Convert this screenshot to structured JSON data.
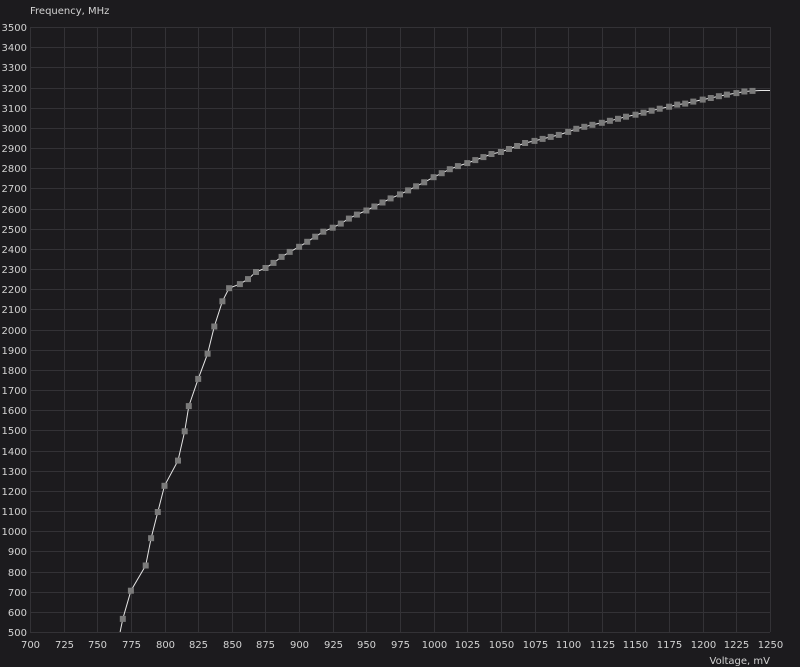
{
  "chart_data": {
    "type": "line",
    "ylabel": "Frequency, MHz",
    "xlabel": "Voltage, mV",
    "xlim": [
      700,
      1250
    ],
    "ylim": [
      500,
      3500
    ],
    "x_ticks": [
      700,
      725,
      750,
      775,
      800,
      825,
      850,
      875,
      900,
      925,
      950,
      975,
      1000,
      1025,
      1050,
      1075,
      1100,
      1125,
      1150,
      1175,
      1200,
      1225,
      1250
    ],
    "y_ticks": [
      500,
      600,
      700,
      800,
      900,
      1000,
      1100,
      1200,
      1300,
      1400,
      1500,
      1600,
      1700,
      1800,
      1900,
      2000,
      2100,
      2200,
      2300,
      2400,
      2500,
      2600,
      2700,
      2800,
      2900,
      3000,
      3100,
      3200,
      3300,
      3400,
      3500
    ],
    "grid": true,
    "colors": {
      "background": "#1c1b1e",
      "grid": "#333236",
      "line": "#e6e6e6",
      "marker": "#7a7a7a",
      "text": "#d2d2d2"
    },
    "series": [
      {
        "points": [
          [
            767,
            500
          ],
          [
            769,
            565
          ],
          [
            775,
            705
          ],
          [
            786,
            830
          ],
          [
            790,
            965
          ],
          [
            795,
            1095
          ],
          [
            800,
            1225
          ],
          [
            810,
            1350
          ],
          [
            815,
            1495
          ],
          [
            818,
            1620
          ],
          [
            825,
            1755
          ],
          [
            832,
            1880
          ],
          [
            837,
            2015
          ],
          [
            843,
            2140
          ],
          [
            848,
            2205
          ],
          [
            856,
            2225
          ],
          [
            862,
            2250
          ],
          [
            868,
            2285
          ],
          [
            875,
            2305
          ],
          [
            881,
            2330
          ],
          [
            887,
            2360
          ],
          [
            893,
            2385
          ],
          [
            900,
            2410
          ],
          [
            906,
            2435
          ],
          [
            912,
            2460
          ],
          [
            918,
            2485
          ],
          [
            925,
            2505
          ],
          [
            931,
            2525
          ],
          [
            937,
            2550
          ],
          [
            943,
            2570
          ],
          [
            950,
            2590
          ],
          [
            956,
            2610
          ],
          [
            962,
            2630
          ],
          [
            968,
            2650
          ],
          [
            975,
            2670
          ],
          [
            981,
            2690
          ],
          [
            987,
            2710
          ],
          [
            993,
            2730
          ],
          [
            1000,
            2755
          ],
          [
            1006,
            2775
          ],
          [
            1012,
            2795
          ],
          [
            1018,
            2810
          ],
          [
            1025,
            2825
          ],
          [
            1031,
            2840
          ],
          [
            1037,
            2855
          ],
          [
            1043,
            2870
          ],
          [
            1050,
            2880
          ],
          [
            1056,
            2895
          ],
          [
            1062,
            2910
          ],
          [
            1068,
            2925
          ],
          [
            1075,
            2935
          ],
          [
            1081,
            2945
          ],
          [
            1087,
            2955
          ],
          [
            1093,
            2965
          ],
          [
            1100,
            2980
          ],
          [
            1106,
            2995
          ],
          [
            1112,
            3005
          ],
          [
            1118,
            3015
          ],
          [
            1125,
            3025
          ],
          [
            1131,
            3035
          ],
          [
            1137,
            3045
          ],
          [
            1143,
            3055
          ],
          [
            1150,
            3065
          ],
          [
            1156,
            3075
          ],
          [
            1162,
            3085
          ],
          [
            1168,
            3095
          ],
          [
            1175,
            3105
          ],
          [
            1181,
            3115
          ],
          [
            1187,
            3120
          ],
          [
            1193,
            3130
          ],
          [
            1200,
            3140
          ],
          [
            1206,
            3148
          ],
          [
            1212,
            3157
          ],
          [
            1218,
            3165
          ],
          [
            1225,
            3172
          ],
          [
            1231,
            3180
          ],
          [
            1237,
            3183
          ],
          [
            1243,
            3185
          ],
          [
            1250,
            3185
          ]
        ],
        "markers": [
          [
            769,
            565
          ],
          [
            775,
            705
          ],
          [
            786,
            830
          ],
          [
            790,
            965
          ],
          [
            795,
            1095
          ],
          [
            800,
            1225
          ],
          [
            810,
            1350
          ],
          [
            815,
            1495
          ],
          [
            818,
            1620
          ],
          [
            825,
            1755
          ],
          [
            832,
            1880
          ],
          [
            837,
            2015
          ],
          [
            843,
            2140
          ],
          [
            848,
            2205
          ],
          [
            856,
            2225
          ],
          [
            862,
            2250
          ],
          [
            868,
            2285
          ],
          [
            875,
            2305
          ],
          [
            881,
            2330
          ],
          [
            887,
            2360
          ],
          [
            893,
            2385
          ],
          [
            900,
            2410
          ],
          [
            906,
            2435
          ],
          [
            912,
            2460
          ],
          [
            918,
            2485
          ],
          [
            925,
            2505
          ],
          [
            931,
            2525
          ],
          [
            937,
            2550
          ],
          [
            943,
            2570
          ],
          [
            950,
            2590
          ],
          [
            956,
            2610
          ],
          [
            962,
            2630
          ],
          [
            968,
            2650
          ],
          [
            975,
            2670
          ],
          [
            981,
            2690
          ],
          [
            987,
            2710
          ],
          [
            993,
            2730
          ],
          [
            1000,
            2755
          ],
          [
            1006,
            2775
          ],
          [
            1012,
            2795
          ],
          [
            1018,
            2810
          ],
          [
            1025,
            2825
          ],
          [
            1031,
            2840
          ],
          [
            1037,
            2855
          ],
          [
            1043,
            2870
          ],
          [
            1050,
            2880
          ],
          [
            1056,
            2895
          ],
          [
            1062,
            2910
          ],
          [
            1068,
            2925
          ],
          [
            1075,
            2935
          ],
          [
            1081,
            2945
          ],
          [
            1087,
            2955
          ],
          [
            1093,
            2965
          ],
          [
            1100,
            2980
          ],
          [
            1106,
            2995
          ],
          [
            1112,
            3005
          ],
          [
            1118,
            3015
          ],
          [
            1125,
            3025
          ],
          [
            1131,
            3035
          ],
          [
            1137,
            3045
          ],
          [
            1143,
            3055
          ],
          [
            1150,
            3065
          ],
          [
            1156,
            3075
          ],
          [
            1162,
            3085
          ],
          [
            1168,
            3095
          ],
          [
            1175,
            3105
          ],
          [
            1181,
            3115
          ],
          [
            1187,
            3120
          ],
          [
            1193,
            3130
          ],
          [
            1200,
            3140
          ],
          [
            1206,
            3148
          ],
          [
            1212,
            3157
          ],
          [
            1218,
            3165
          ],
          [
            1225,
            3172
          ],
          [
            1231,
            3180
          ],
          [
            1237,
            3183
          ]
        ]
      }
    ]
  }
}
